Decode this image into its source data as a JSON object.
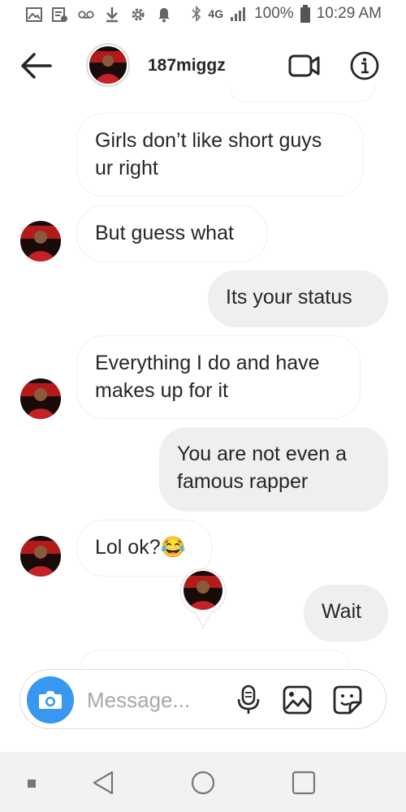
{
  "status_bar": {
    "battery": "100%",
    "time": "10:29 AM",
    "network": "4G"
  },
  "header": {
    "username": "187miggz"
  },
  "messages": [
    {
      "side": "received",
      "text": "Girls don’t like short guys\nur right"
    },
    {
      "side": "received",
      "text": "But guess what"
    },
    {
      "side": "sent",
      "text": "Its your status"
    },
    {
      "side": "received",
      "text": "Everything I do and have\nmakes up for it"
    },
    {
      "side": "sent",
      "text": "You are not even a\nfamous rapper"
    },
    {
      "side": "received",
      "text": "Lol ok?😂"
    },
    {
      "side": "sent",
      "text": "Wait"
    }
  ],
  "composer": {
    "placeholder": "Message..."
  },
  "colors": {
    "accent": "#3897f0",
    "sent_bubble": "#efefef",
    "received_border": "#efefef"
  }
}
